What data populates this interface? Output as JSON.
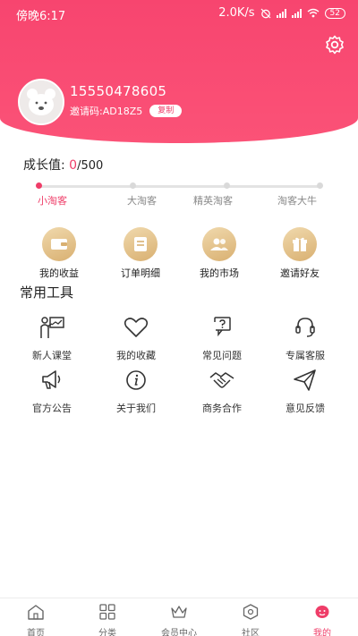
{
  "status_bar": {
    "time": "傍晚6:17",
    "speed": "2.0K/s",
    "battery": "52"
  },
  "profile": {
    "phone": "15550478605",
    "invite_label": "邀请码:AD18Z5",
    "copy_label": "复制"
  },
  "growth": {
    "label": "成长值: ",
    "current": "0",
    "max": "/500",
    "progress_fraction": 0.0,
    "levels": [
      "小淘客",
      "大淘客",
      "精英淘客",
      "淘客大牛"
    ],
    "active_level": "小淘客"
  },
  "quick_actions": [
    {
      "label": "我的收益",
      "icon": "wallet-icon"
    },
    {
      "label": "订单明细",
      "icon": "order-list-icon"
    },
    {
      "label": "我的市场",
      "icon": "users-icon"
    },
    {
      "label": "邀请好友",
      "icon": "gift-icon"
    }
  ],
  "tools": {
    "title": "常用工具",
    "items": [
      {
        "label": "新人课堂",
        "icon": "presenter-icon"
      },
      {
        "label": "我的收藏",
        "icon": "heart-icon"
      },
      {
        "label": "常见问题",
        "icon": "question-icon"
      },
      {
        "label": "专属客服",
        "icon": "headset-icon"
      },
      {
        "label": "官方公告",
        "icon": "megaphone-icon"
      },
      {
        "label": "关于我们",
        "icon": "info-icon"
      },
      {
        "label": "商务合作",
        "icon": "handshake-icon"
      },
      {
        "label": "意见反馈",
        "icon": "send-icon"
      }
    ]
  },
  "nav": [
    {
      "label": "首页",
      "icon": "home-icon"
    },
    {
      "label": "分类",
      "icon": "grid-icon"
    },
    {
      "label": "会员中心",
      "icon": "crown-icon"
    },
    {
      "label": "社区",
      "icon": "hexagon-icon"
    },
    {
      "label": "我的",
      "icon": "profile-icon"
    }
  ],
  "colors": {
    "accent": "#ef3d68",
    "header": "#f7456f",
    "gold": "#d9b071"
  }
}
